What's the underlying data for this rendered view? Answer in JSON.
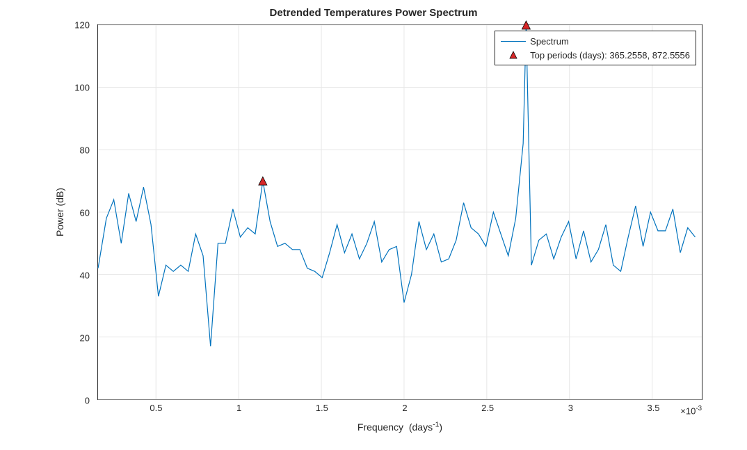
{
  "chart_data": {
    "type": "line",
    "title": "Detrended Temperatures Power Spectrum",
    "xlabel": "Frequency  (days⁻¹)",
    "ylabel": "Power (dB)",
    "x_exponent_label": "×10⁻³",
    "xlim": [
      0.15,
      3.8
    ],
    "ylim": [
      0,
      120
    ],
    "xticks": [
      0.5,
      1,
      1.5,
      2,
      2.5,
      3,
      3.5
    ],
    "xtick_labels": [
      "0.5",
      "1",
      "1.5",
      "2",
      "2.5",
      "3",
      "3.5"
    ],
    "yticks": [
      0,
      20,
      40,
      60,
      80,
      100,
      120
    ],
    "ytick_labels": [
      "0",
      "20",
      "40",
      "60",
      "80",
      "100",
      "120"
    ],
    "series": [
      {
        "name": "Spectrum",
        "color": "#0072BD",
        "x": [
          0.15,
          0.2,
          0.245,
          0.29,
          0.335,
          0.38,
          0.425,
          0.47,
          0.515,
          0.56,
          0.605,
          0.65,
          0.695,
          0.74,
          0.785,
          0.83,
          0.875,
          0.92,
          0.965,
          1.01,
          1.055,
          1.1,
          1.146,
          1.19,
          1.235,
          1.28,
          1.325,
          1.37,
          1.415,
          1.46,
          1.505,
          1.55,
          1.595,
          1.64,
          1.685,
          1.73,
          1.775,
          1.82,
          1.865,
          1.91,
          1.955,
          2.0,
          2.045,
          2.09,
          2.135,
          2.18,
          2.225,
          2.27,
          2.315,
          2.36,
          2.405,
          2.45,
          2.495,
          2.54,
          2.585,
          2.63,
          2.675,
          2.72,
          2.738,
          2.77,
          2.815,
          2.86,
          2.905,
          2.95,
          2.995,
          3.04,
          3.085,
          3.13,
          3.175,
          3.22,
          3.265,
          3.31,
          3.355,
          3.4,
          3.445,
          3.49,
          3.535,
          3.58,
          3.625,
          3.67,
          3.715,
          3.76
        ],
        "y": [
          42,
          58,
          64,
          50,
          66,
          57,
          68,
          56,
          33,
          43,
          41,
          43,
          41,
          53,
          46,
          17,
          50,
          50,
          61,
          52,
          55,
          53,
          70,
          57,
          49,
          50,
          48,
          48,
          42,
          41,
          39,
          47,
          56,
          47,
          53,
          45,
          50,
          57,
          44,
          48,
          49,
          31,
          40,
          57,
          48,
          53,
          44,
          45,
          51,
          63,
          55,
          53,
          49,
          60,
          53,
          46,
          58,
          82,
          120,
          43,
          51,
          53,
          45,
          52,
          57,
          45,
          54,
          44,
          48,
          56,
          43,
          41,
          52,
          62,
          49,
          60,
          54,
          54,
          61,
          47,
          55,
          52
        ]
      }
    ],
    "markers": {
      "name": "Top periods (days): 365.2558, 872.5556",
      "color": "#D62728",
      "points": [
        {
          "x": 2.738,
          "y": 120
        },
        {
          "x": 1.146,
          "y": 70
        }
      ]
    },
    "legend": {
      "position": "northeast",
      "entries": [
        {
          "type": "line",
          "label": "Spectrum"
        },
        {
          "type": "marker",
          "label": "Top periods (days): 365.2558, 872.5556"
        }
      ]
    }
  }
}
